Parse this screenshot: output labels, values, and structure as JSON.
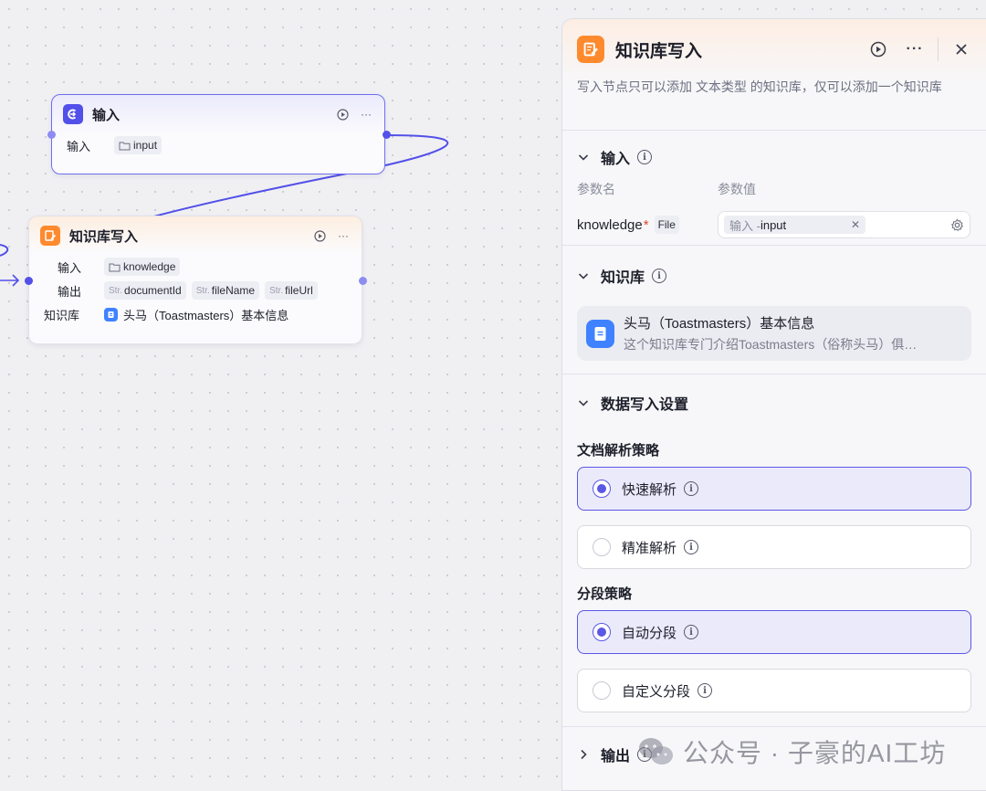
{
  "canvas": {
    "input_node": {
      "title": "输入",
      "row_label": "输入",
      "param": "input"
    },
    "kw_node": {
      "title": "知识库写入",
      "input_label": "输入",
      "input_param": "knowledge",
      "output_label": "输出",
      "outputs": [
        {
          "type": "Str.",
          "name": "documentId"
        },
        {
          "type": "Str.",
          "name": "fileName"
        },
        {
          "type": "Str.",
          "name": "fileUrl"
        }
      ],
      "kb_label": "知识库",
      "kb_value": "头马（Toastmasters）基本信息"
    }
  },
  "panel": {
    "title": "知识库写入",
    "description": "写入节点只可以添加 文本类型 的知识库，仅可以添加一个知识库",
    "input_section": {
      "title": "输入",
      "col_name": "参数名",
      "col_value": "参数值",
      "param_name": "knowledge",
      "param_type": "File",
      "ref_source": "输入 - ",
      "ref_param": "input"
    },
    "kb_section": {
      "title": "知识库",
      "kb_name": "头马（Toastmasters）基本信息",
      "kb_desc": "这个知识库专门介绍Toastmasters（俗称头马）俱…"
    },
    "write_section": {
      "title": "数据写入设置",
      "parse_title": "文档解析策略",
      "parse_options": [
        {
          "label": "快速解析",
          "selected": true
        },
        {
          "label": "精准解析",
          "selected": false
        }
      ],
      "chunk_title": "分段策略",
      "chunk_options": [
        {
          "label": "自动分段",
          "selected": true
        },
        {
          "label": "自定义分段",
          "selected": false
        }
      ]
    },
    "output_section": {
      "title": "输出"
    }
  },
  "watermark": "公众号 · 子豪的AI工坊",
  "colors": {
    "accent": "#5b58e6",
    "node_orange": "#ff8a2e",
    "kb_blue": "#3f82ff",
    "edge": "#5250e8"
  }
}
